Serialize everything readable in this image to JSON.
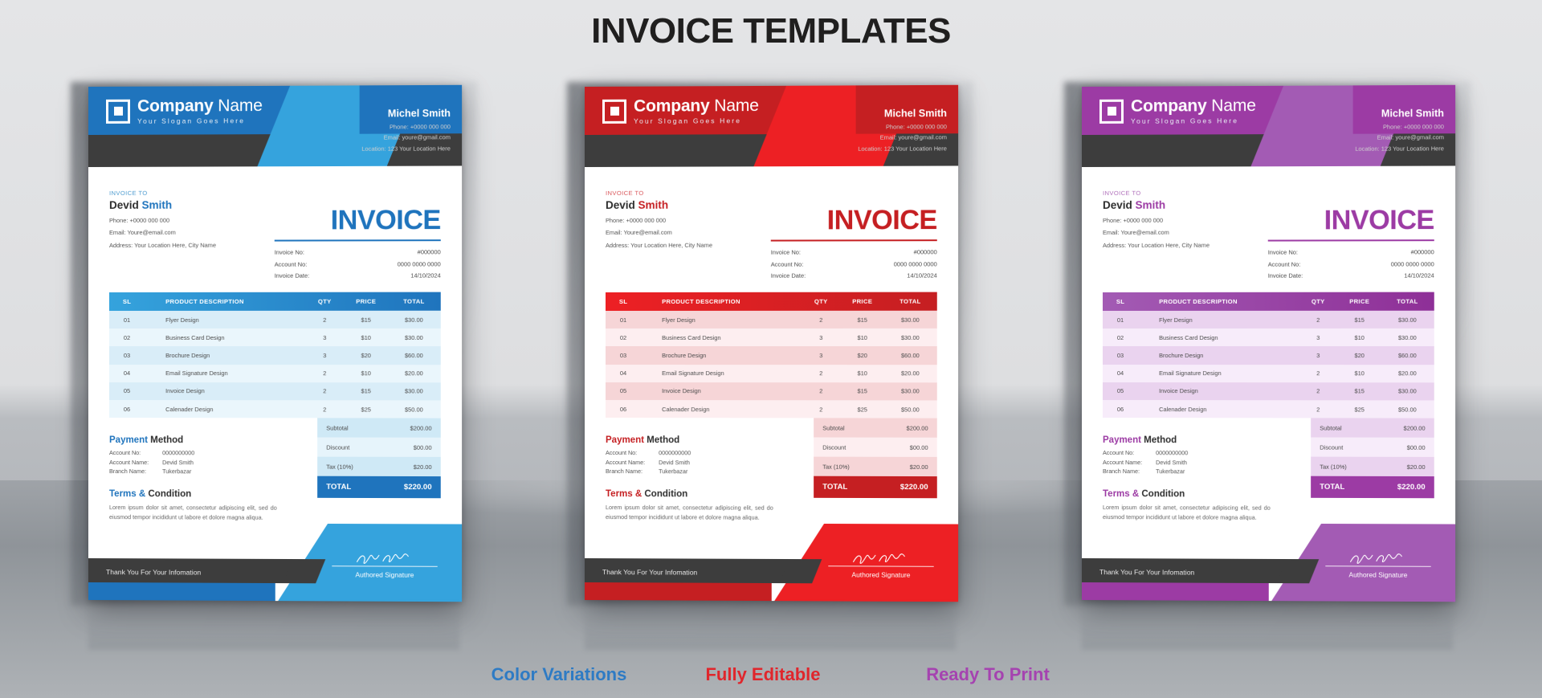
{
  "page": {
    "title": "INVOICE TEMPLATES"
  },
  "captions": [
    {
      "label": "Color Variations",
      "color": "#2e7bc4"
    },
    {
      "label": "Fully Editable",
      "color": "#e0262c"
    },
    {
      "label": "Ready To Print",
      "color": "#a543b0"
    }
  ],
  "invoice": {
    "brand": {
      "name_bold": "Company",
      "name_light": " Name",
      "slogan": "Your Slogan Goes Here",
      "logo_icon": "square-logo-icon"
    },
    "contact": {
      "name": "Michel Smith",
      "phone": "Phone: +0000 000 000",
      "email": "Email: youre@gmail.com",
      "location": "Location: 123 Your Location Here"
    },
    "invoice_to": {
      "label": "INVOICE TO",
      "name_bold": "Devid",
      "name_light": " Smith",
      "phone": "Phone:  +0000 000 000",
      "email": "Email:  Youre@email.com",
      "address": "Address: Your Location Here, City Name"
    },
    "heading": "INVOICE",
    "meta": [
      {
        "key": "Invoice No:",
        "value": "#000000"
      },
      {
        "key": "Account No:",
        "value": "0000 0000 0000"
      },
      {
        "key": "Invoice Date:",
        "value": "14/10/2024"
      }
    ],
    "table": {
      "headers": [
        "SL",
        "PRODUCT DESCRIPTION",
        "QTY",
        "PRICE",
        "TOTAL"
      ],
      "rows": [
        {
          "sl": "01",
          "desc": "Flyer Design",
          "qty": "2",
          "price": "$15",
          "total": "$30.00"
        },
        {
          "sl": "02",
          "desc": "Business Card Design",
          "qty": "3",
          "price": "$10",
          "total": "$30.00"
        },
        {
          "sl": "03",
          "desc": "Brochure Design",
          "qty": "3",
          "price": "$20",
          "total": "$60.00"
        },
        {
          "sl": "04",
          "desc": "Email Signature Design",
          "qty": "2",
          "price": "$10",
          "total": "$20.00"
        },
        {
          "sl": "05",
          "desc": "Invoice Design",
          "qty": "2",
          "price": "$15",
          "total": "$30.00"
        },
        {
          "sl": "06",
          "desc": "Calenader Design",
          "qty": "2",
          "price": "$25",
          "total": "$50.00"
        }
      ]
    },
    "payment": {
      "title_bold": "Payment",
      "title_light": " Method",
      "lines": [
        {
          "key": "Account No:",
          "value": "0000000000"
        },
        {
          "key": "Account Name:",
          "value": "Devid Smith"
        },
        {
          "key": "Branch Name:",
          "value": "Tukerbazar"
        }
      ]
    },
    "terms": {
      "title_bold": "Terms &",
      "title_light": " Condition",
      "body": "Lorem ipsum dolor sit amet, consectetur adipiscing elit, sed do eiusmod tempor incididunt ut labore et dolore magna aliqua."
    },
    "totals": {
      "rows": [
        {
          "key": "Subtotal",
          "value": "$200.00"
        },
        {
          "key": "Discount",
          "value": "$00.00"
        },
        {
          "key": "Tax (10%)",
          "value": "$20.00"
        }
      ],
      "final": {
        "key": "TOTAL",
        "value": "$220.00"
      }
    },
    "footer": {
      "thanks": "Thank You For Your Infomation",
      "signature_label": "Authored Signature",
      "signature_icon": "handwritten-signature-icon"
    }
  },
  "variants": [
    {
      "id": "blue",
      "primary": "#1f74bd",
      "accent": "#35a3dd",
      "dark": "#3d3d3d",
      "row_tint": "#d9edf8",
      "row_tint_alt": "#eaf6fc",
      "head_grad_a": "#35a3dd",
      "head_grad_b": "#1f74bd",
      "tot_tint": "#cfe9f6",
      "tot_tint_alt": "#e6f4fb",
      "title_color": "#1f74bd",
      "label_color": "#4e9cd0"
    },
    {
      "id": "red",
      "primary": "#c51f22",
      "accent": "#ed2024",
      "dark": "#3d3d3d",
      "row_tint": "#f6d5d7",
      "row_tint_alt": "#fdeef0",
      "head_grad_a": "#ed2024",
      "head_grad_b": "#c51f22",
      "tot_tint": "#f6d5d7",
      "tot_tint_alt": "#fdeef0",
      "title_color": "#c51f22",
      "label_color": "#d9565a"
    },
    {
      "id": "purple",
      "primary": "#9c3ba4",
      "accent": "#a35bb4",
      "dark": "#3d3d3d",
      "row_tint": "#ead3ef",
      "row_tint_alt": "#f7ecfa",
      "head_grad_a": "#a35bb4",
      "head_grad_b": "#8e2f97",
      "tot_tint": "#ead3ef",
      "tot_tint_alt": "#f7ecfa",
      "title_color": "#9c3ba4",
      "label_color": "#b070bb"
    }
  ]
}
